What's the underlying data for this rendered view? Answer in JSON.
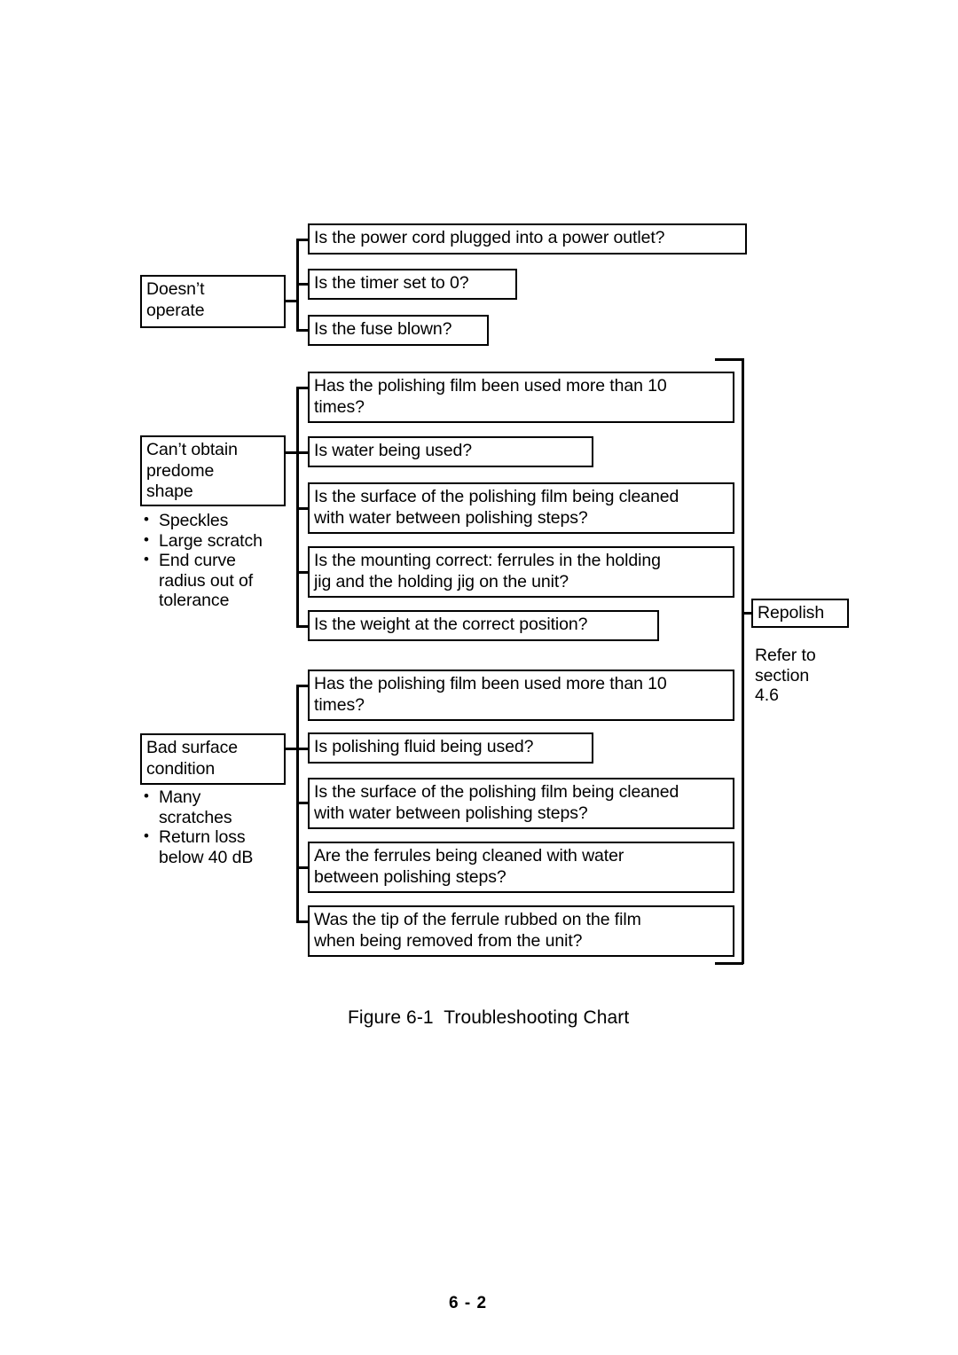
{
  "figure": {
    "caption": "Figure 6-1  Troubleshooting Chart",
    "page_number": "6 - 2"
  },
  "chart_data": {
    "type": "diagram",
    "title": "Figure 6-1  Troubleshooting Chart",
    "diagram_kind": "troubleshooting-tree",
    "groups": [
      {
        "symptom": "Doesn’t\noperate",
        "details": [],
        "checks": [
          "Is the power cord plugged into a power outlet?",
          "Is the timer set to 0?",
          "Is the fuse blown?"
        ],
        "outcome": null
      },
      {
        "symptom": "Can’t obtain\npredome\nshape",
        "details": [
          "Speckles",
          "Large scratch",
          "End curve\nradius out of\ntolerance"
        ],
        "checks": [
          "Has the polishing film been used more than 10\ntimes?",
          "Is water being used?",
          "Is the surface of the polishing film being cleaned\nwith water between polishing steps?",
          "Is the mounting correct:  ferrules in the holding\njig and the holding jig on the unit?",
          "Is the weight at the correct position?"
        ],
        "outcome": "Repolish"
      },
      {
        "symptom": "Bad surface\ncondition",
        "details": [
          "Many\nscratches",
          "Return loss\nbelow 40 dB"
        ],
        "checks": [
          "Has the polishing film been used more than 10\ntimes?",
          "Is polishing fluid being used?",
          "Is the surface of the polishing film being cleaned\nwith water between polishing steps?",
          "Are the ferrules being cleaned with water\nbetween polishing steps?",
          "Was the tip of the ferrule rubbed on the film\nwhen being removed from the unit?"
        ],
        "outcome": "Repolish"
      }
    ],
    "result": {
      "label": "Repolish",
      "note": "Refer to\nsection\n4.6"
    }
  },
  "symptoms": {
    "doesnt_operate": "Doesn’t\noperate",
    "cant_obtain_predome_shape": "Can’t obtain\npredome\nshape",
    "bad_surface_condition": "Bad surface\ncondition"
  },
  "details": {
    "predome": [
      "Speckles",
      "Large scratch",
      "End curve\nradius out of\ntolerance"
    ],
    "surface": [
      "Many\nscratches",
      "Return loss\nbelow 40 dB"
    ]
  },
  "checks": {
    "g1": [
      "Is the power cord plugged into a power outlet?",
      "Is the timer set to 0?",
      "Is the fuse blown?"
    ],
    "g2": [
      "Has the polishing film been used more than 10\ntimes?",
      "Is water being used?",
      "Is the surface of the polishing film being cleaned\nwith water between polishing steps?",
      "Is the mounting correct:  ferrules in the holding\njig and the holding jig on the unit?",
      "Is the weight at the correct position?"
    ],
    "g3": [
      "Has the polishing film been used more than 10\ntimes?",
      "Is polishing fluid being used?",
      "Is the surface of the polishing film being cleaned\nwith water between polishing steps?",
      "Are the ferrules being cleaned with water\nbetween polishing steps?",
      "Was the tip of the ferrule rubbed on the film\nwhen being removed from the unit?"
    ]
  },
  "result": {
    "label": "Repolish",
    "note": "Refer to\nsection\n4.6"
  },
  "colors": {
    "ink": "#000000",
    "paper": "#ffffff"
  }
}
